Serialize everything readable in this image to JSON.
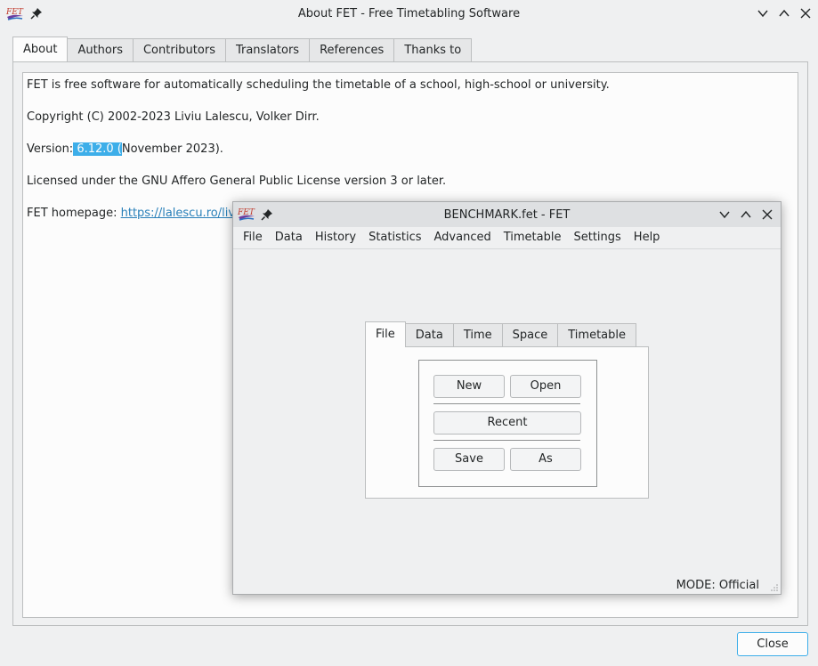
{
  "window": {
    "title": "About FET - Free Timetabling Software",
    "icon": "fet-logo-icon"
  },
  "tabs": [
    {
      "label": "About",
      "active": true
    },
    {
      "label": "Authors"
    },
    {
      "label": "Contributors"
    },
    {
      "label": "Translators"
    },
    {
      "label": "References"
    },
    {
      "label": "Thanks to"
    }
  ],
  "about": {
    "description": "FET is free software for automatically scheduling the timetable of a school, high-school or university.",
    "copyright": "Copyright (C) 2002-2023 Liviu Lalescu, Volker Dirr.",
    "version_prefix": "Version:",
    "version_selected": " 6.12.0 (",
    "version_suffix": "November 2023).",
    "license": "Licensed under the GNU Affero General Public License version 3 or later.",
    "homepage_prefix": "FET homepage: ",
    "homepage_link": "https://lalescu.ro/liviu/"
  },
  "buttons": {
    "close": "Close"
  },
  "child_window": {
    "title": "BENCHMARK.fet - FET",
    "menu": [
      "File",
      "Data",
      "History",
      "Statistics",
      "Advanced",
      "Timetable",
      "Settings",
      "Help"
    ],
    "tabs": [
      {
        "label": "File",
        "active": true
      },
      {
        "label": "Data"
      },
      {
        "label": "Time"
      },
      {
        "label": "Space"
      },
      {
        "label": "Timetable"
      }
    ],
    "buttons": {
      "new": "New",
      "open": "Open",
      "recent": "Recent",
      "save": "Save",
      "save_as": "As"
    },
    "status": "MODE: Official"
  },
  "colors": {
    "selection": "#3daee9",
    "link": "#2980b9",
    "background": "#eff0f1"
  }
}
